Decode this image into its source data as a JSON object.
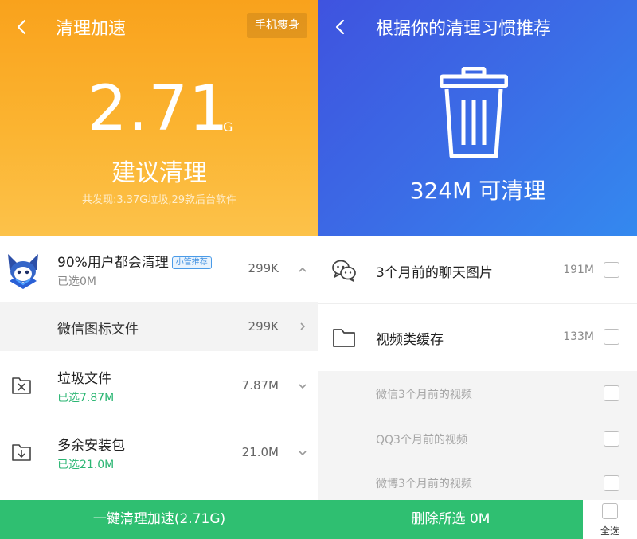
{
  "left": {
    "title": "清理加速",
    "slim_button": "手机瘦身",
    "total_value": "2.71",
    "total_unit": "G",
    "suggest_label": "建议清理",
    "found_text": "共发现:3.37G垃圾,29款后台软件",
    "app_item": {
      "name": "90%用户都会清理",
      "badge": "小管推荐",
      "selected": "已选0M",
      "size": "299K"
    },
    "sub_item": {
      "name": "微信图标文件",
      "size": "299K"
    },
    "junk_item": {
      "name": "垃圾文件",
      "selected": "已选7.87M",
      "size": "7.87M"
    },
    "apk_item": {
      "name": "多余安装包",
      "selected": "已选21.0M",
      "size": "21.0M"
    },
    "clean_button": "一键清理加速(2.71G)"
  },
  "right": {
    "title": "根据你的清理习惯推荐",
    "amount_text": "324M 可清理",
    "items": [
      {
        "name": "3个月前的聊天图片",
        "size": "191M",
        "icon": "wechat-icon"
      },
      {
        "name": "视频类缓存",
        "size": "133M",
        "icon": "folder-icon"
      }
    ],
    "sub_items": [
      {
        "name": "微信3个月前的视频"
      },
      {
        "name": "QQ3个月前的视频"
      },
      {
        "name": "微博3个月前的视频"
      }
    ],
    "delete_button": "删除所选 0M",
    "select_all": "全选"
  }
}
